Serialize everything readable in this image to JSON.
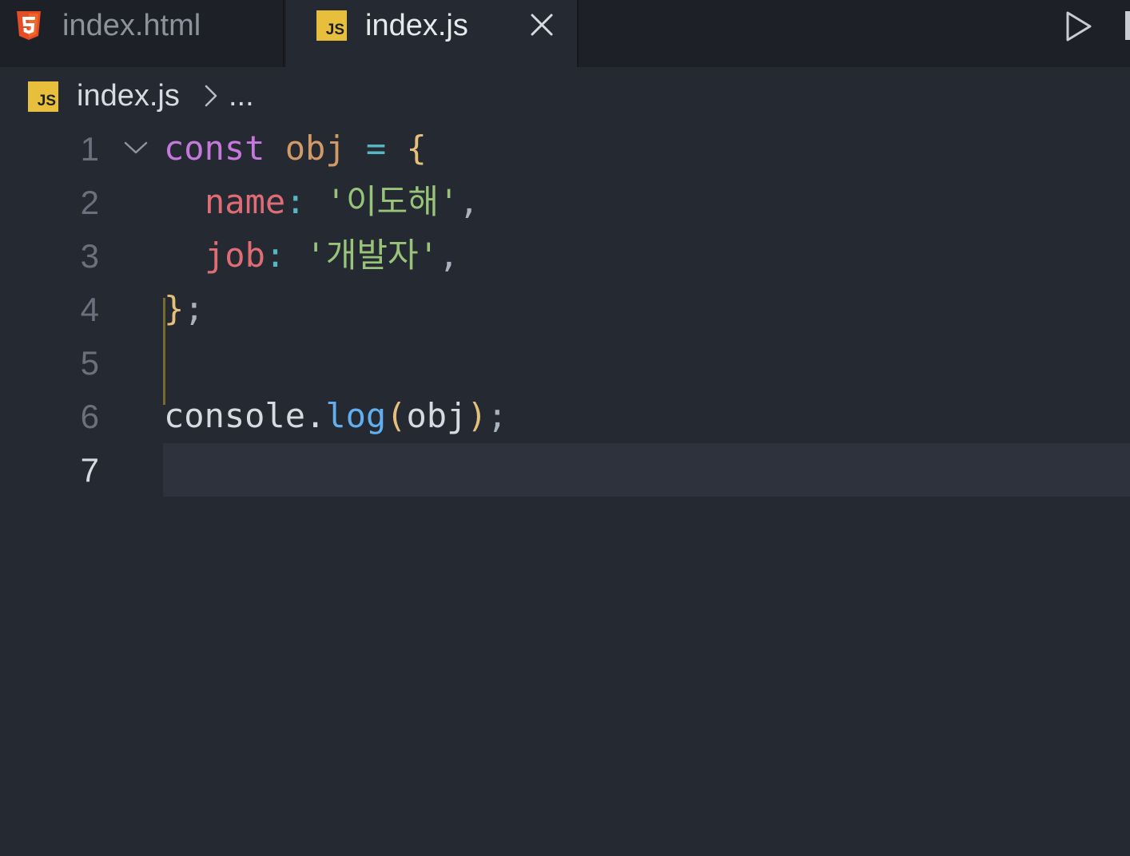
{
  "tabs": [
    {
      "label": "index.html",
      "icon": "html5-icon",
      "active": false
    },
    {
      "label": "index.js",
      "icon": "js-icon",
      "badge": "JS",
      "active": true
    }
  ],
  "toolbar": {
    "run_icon": "play-icon"
  },
  "breadcrumb": {
    "badge": "JS",
    "file": "index.js",
    "more": "..."
  },
  "editor": {
    "current_line": 7,
    "lines": [
      {
        "number": "1",
        "tokens": {
          "kw": "const",
          "var": "obj",
          "op": "=",
          "brace": "{"
        }
      },
      {
        "number": "2",
        "tokens": {
          "prop": "name",
          "colon": ":",
          "str": "'이도해'",
          "comma": ","
        }
      },
      {
        "number": "3",
        "tokens": {
          "prop": "job",
          "colon": ":",
          "str": "'개발자'",
          "comma": ","
        }
      },
      {
        "number": "4",
        "tokens": {
          "brace": "}",
          "semi": ";"
        }
      },
      {
        "number": "5",
        "tokens": {}
      },
      {
        "number": "6",
        "tokens": {
          "obj": "console",
          "dot": ".",
          "func": "log",
          "open": "(",
          "arg": "obj",
          "close": ")",
          "semi": ";"
        }
      },
      {
        "number": "7",
        "tokens": {}
      }
    ]
  },
  "colors": {
    "keyword": "#c678dd",
    "variable": "#d19a66",
    "property": "#e06c75",
    "string": "#98c379",
    "function": "#61afef",
    "brace": "#e5c07b",
    "js_badge": "#e8bf3c",
    "html5": "#e44d26"
  }
}
